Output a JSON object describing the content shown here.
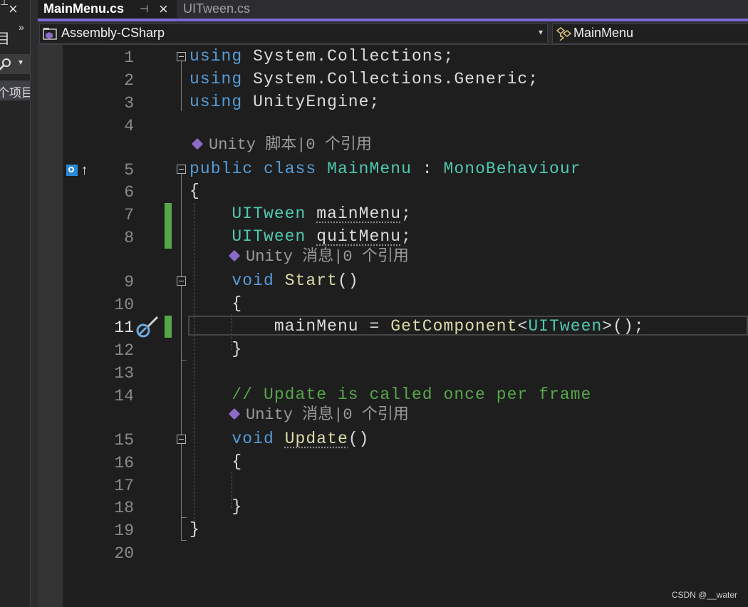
{
  "left_panel": {
    "close_glyph": "×",
    "expand_glyph": "»",
    "search_dropdown": "▾",
    "partial_label": "个项目",
    "partial_top": "目"
  },
  "tabs": [
    {
      "label": "MainMenu.cs",
      "active": true,
      "pin_glyph": "⊣",
      "close_glyph": "×"
    },
    {
      "label": "UITween.cs",
      "active": false
    }
  ],
  "accent_color": "#7b68d8",
  "navbar": {
    "project": "Assembly-CSharp",
    "project_dropdown": "▾",
    "class": "MainMenu"
  },
  "line_numbers": [
    "1",
    "2",
    "3",
    "4",
    "5",
    "6",
    "7",
    "8",
    "9",
    "10",
    "11",
    "12",
    "13",
    "14",
    "15",
    "16",
    "17",
    "18",
    "19",
    "20"
  ],
  "current_line": "11",
  "code": {
    "l1": {
      "kw": "using",
      "rest": "System.Collections;"
    },
    "l2": {
      "kw": "using",
      "rest": "System.Collections.Generic;"
    },
    "l3": {
      "kw": "using",
      "rest": "UnityEngine;"
    },
    "lens_class": "Unity 脚本|0 个引用",
    "l5": {
      "kw1": "public",
      "kw2": "class",
      "name": "MainMenu",
      "colon": ":",
      "base": "MonoBehaviour"
    },
    "l6": "{",
    "l7": {
      "type": "UITween",
      "name": "mainMenu",
      "end": ";"
    },
    "l8": {
      "type": "UITween",
      "name": "quitMenu",
      "end": ";"
    },
    "lens_start": "Unity 消息|0 个引用",
    "l9": {
      "kw": "void",
      "name": "Start",
      "parens": "()"
    },
    "l10": "{",
    "l11": {
      "target": "mainMenu",
      "op": "=",
      "call": "GetComponent",
      "lt": "<",
      "type": "UITween",
      "gt": ">",
      "end": "();"
    },
    "l12": "}",
    "l14": "// Update is called once per frame",
    "lens_update": "Unity 消息|0 个引用",
    "l15": {
      "kw": "void",
      "name": "Update",
      "parens": "()"
    },
    "l16": "{",
    "l18": "}",
    "l19": "}"
  },
  "watermark": "CSDN @__water"
}
